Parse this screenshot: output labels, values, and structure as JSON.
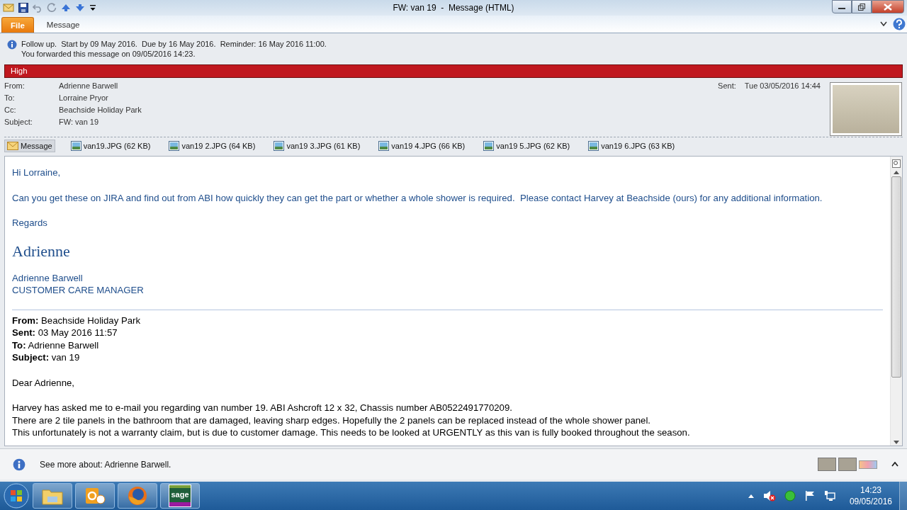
{
  "window": {
    "title": "FW: van 19  -  Message (HTML)"
  },
  "ribbon_tabs": [
    {
      "label": "File",
      "kind": "backstage"
    },
    {
      "label": "Message",
      "kind": "tab"
    }
  ],
  "info_bar": {
    "lines": [
      "Follow up.  Start by 09 May 2016.  Due by 16 May 2016.  Reminder: 16 May 2016 11:00.",
      "You forwarded this message on 09/05/2016 14:23."
    ]
  },
  "importance": "High",
  "header": {
    "fields": [
      {
        "label": "From:",
        "value": "Adrienne Barwell"
      },
      {
        "label": "To:",
        "value": "Lorraine Pryor"
      },
      {
        "label": "Cc:",
        "value": "Beachside Holiday Park"
      },
      {
        "label": "Subject:",
        "value": "FW: van 19"
      }
    ],
    "sent": {
      "label": "Sent:",
      "value": "Tue 03/05/2016 14:44"
    }
  },
  "attachments": [
    {
      "label": "Message",
      "kind": "message",
      "selected": true
    },
    {
      "label": "van19.JPG (62 KB)",
      "kind": "image",
      "selected": false
    },
    {
      "label": "van19 2.JPG (64 KB)",
      "kind": "image",
      "selected": false
    },
    {
      "label": "van19 3.JPG (61 KB)",
      "kind": "image",
      "selected": false
    },
    {
      "label": "van19 4.JPG (66 KB)",
      "kind": "image",
      "selected": false
    },
    {
      "label": "van19 5.JPG (62 KB)",
      "kind": "image",
      "selected": false
    },
    {
      "label": "van19 6.JPG (63 KB)",
      "kind": "image",
      "selected": false
    }
  ],
  "body": {
    "greeting": "Hi Lorraine,",
    "paragraph": "Can you get these on JIRA and find out from ABI how quickly they can get the part or whether a whole shower is required.  Please contact Harvey at Beachside (ours) for any additional information.",
    "closing": "Regards",
    "signature": "Adrienne",
    "sender_name": "Adrienne Barwell",
    "sender_title": "CUSTOMER CARE MANAGER",
    "forwarded_fields": [
      {
        "label": "From:",
        "value": "Beachside Holiday Park"
      },
      {
        "label": "Sent:",
        "value": "03 May 2016 11:57"
      },
      {
        "label": "To:",
        "value": "Adrienne Barwell"
      },
      {
        "label": "Subject:",
        "value": "van 19"
      }
    ],
    "forwarded_greeting": "Dear Adrienne,",
    "forwarded_lines": [
      "Harvey has asked me to e-mail you regarding van number 19. ABI Ashcroft 12 x 32, Chassis number AB0522491770209.",
      "There are 2 tile panels in the bathroom that are damaged, leaving sharp edges. Hopefully the 2 panels can be replaced instead of the whole shower panel.",
      "This unfortunately is not a warranty claim, but is due to customer damage. This needs to be looked at URGENTLY as this van is fully booked throughout the season."
    ]
  },
  "people_pane": {
    "text": "See more about: Adrienne Barwell."
  },
  "taskbar": {
    "apps": [
      {
        "kind": "explorer"
      },
      {
        "kind": "outlook"
      },
      {
        "kind": "firefox"
      },
      {
        "kind": "sage",
        "label": "sage"
      }
    ],
    "clock": {
      "time": "14:23",
      "date": "09/05/2016"
    }
  }
}
